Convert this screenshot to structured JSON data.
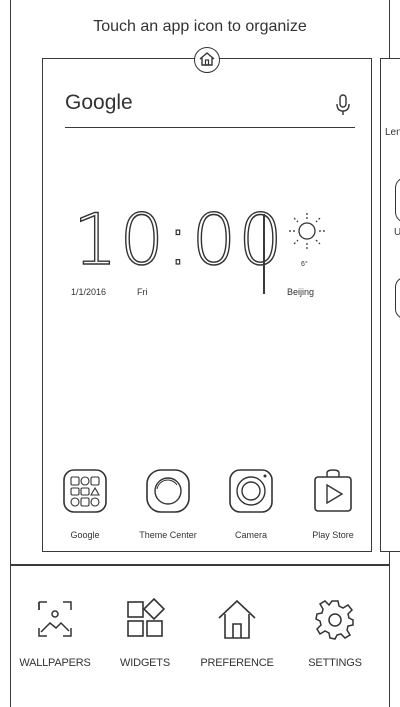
{
  "hint": "Touch an app icon to organize",
  "search": {
    "label": "Google"
  },
  "clock": {
    "hour": "10",
    "minute": "00",
    "date": "1/1/2016",
    "day": "Fri"
  },
  "weather": {
    "temp": "6°",
    "city": "Beijing"
  },
  "peek": {
    "text1": "Len",
    "text2": "U"
  },
  "dock": [
    {
      "label": "Google",
      "icon": "google-folder-icon"
    },
    {
      "label": "Theme Center",
      "icon": "theme-center-icon"
    },
    {
      "label": "Camera",
      "icon": "camera-icon"
    },
    {
      "label": "Play Store",
      "icon": "play-store-icon"
    }
  ],
  "menu": [
    {
      "label": "WALLPAPERS",
      "icon": "wallpapers-icon"
    },
    {
      "label": "WIDGETS",
      "icon": "widgets-icon"
    },
    {
      "label": "PREFERENCE",
      "icon": "preference-icon"
    },
    {
      "label": "SETTINGS",
      "icon": "settings-icon"
    }
  ]
}
